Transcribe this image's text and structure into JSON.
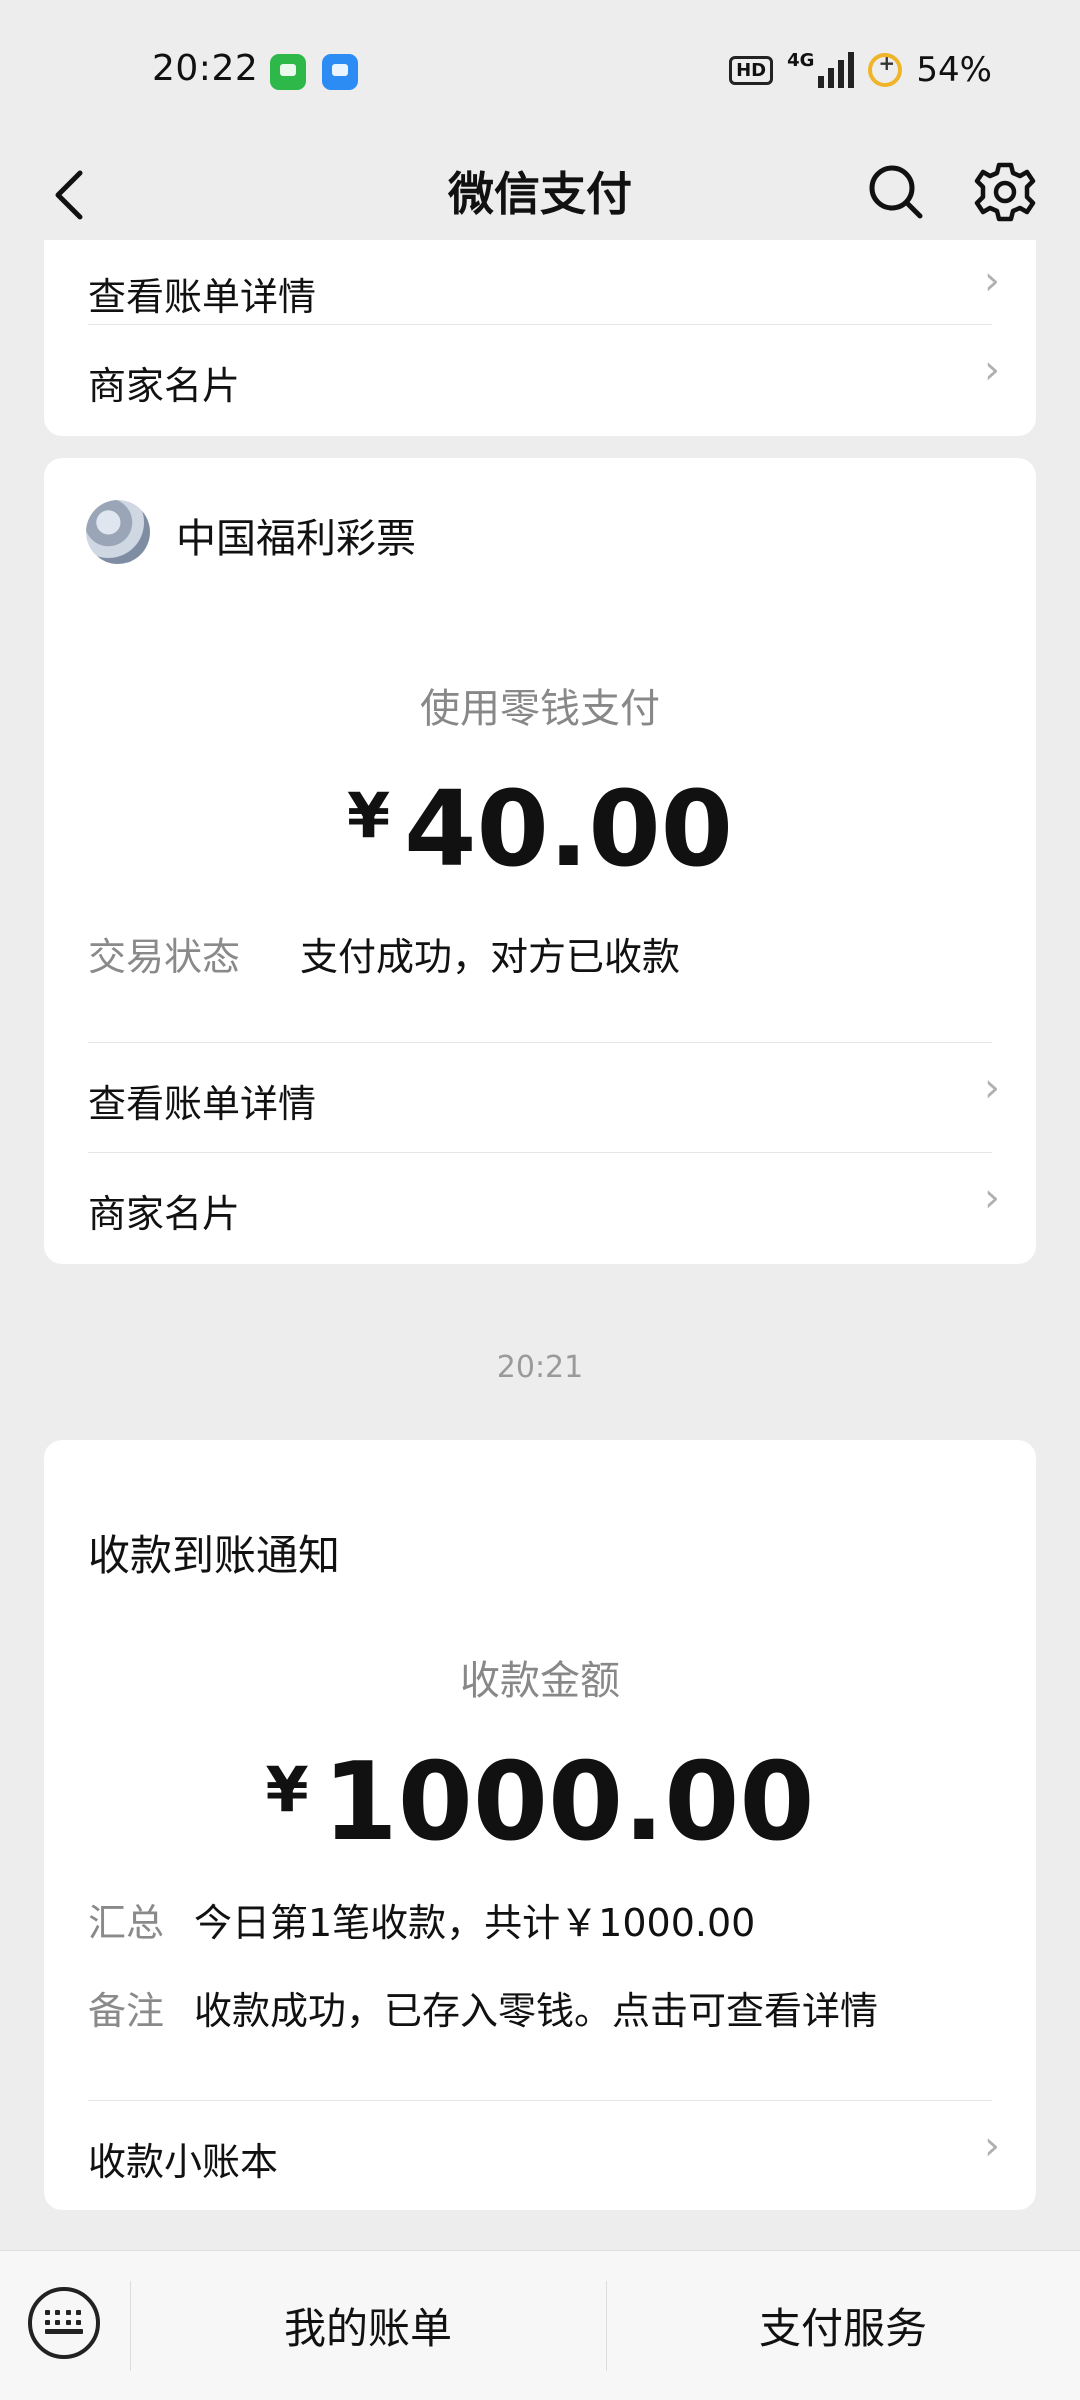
{
  "status_bar": {
    "time": "20:22",
    "network": "4G",
    "hd_badge": "HD",
    "battery": "54%"
  },
  "nav": {
    "back_icon": "chevron-left-icon",
    "title": "微信支付",
    "search_icon": "search-icon",
    "settings_icon": "gear-icon"
  },
  "card_top": {
    "rows": [
      {
        "label": "查看账单详情"
      },
      {
        "label": "商家名片"
      }
    ]
  },
  "payment_card": {
    "merchant": "中国福利彩票",
    "subtitle": "使用零钱支付",
    "currency": "¥",
    "amount": "40.00",
    "status_key": "交易状态",
    "status_value": "支付成功，对方已收款",
    "rows": [
      {
        "label": "查看账单详情"
      },
      {
        "label": "商家名片"
      }
    ]
  },
  "timestamp": "20:21",
  "receipt_card": {
    "title": "收款到账通知",
    "subtitle": "收款金额",
    "currency": "¥",
    "amount": "1000.00",
    "summary_key": "汇总",
    "summary_value": "今日第1笔收款，共计￥1000.00",
    "note_key": "备注",
    "note_value": "收款成功，已存入零钱。点击可查看详情",
    "row": {
      "label": "收款小账本"
    }
  },
  "bottom_bar": {
    "keyboard_icon": "keyboard-icon",
    "tabs": [
      {
        "label": "我的账单"
      },
      {
        "label": "支付服务"
      }
    ]
  },
  "colors": {
    "background": "#ededed",
    "card": "#ffffff",
    "muted_text": "#8a8a8a"
  }
}
